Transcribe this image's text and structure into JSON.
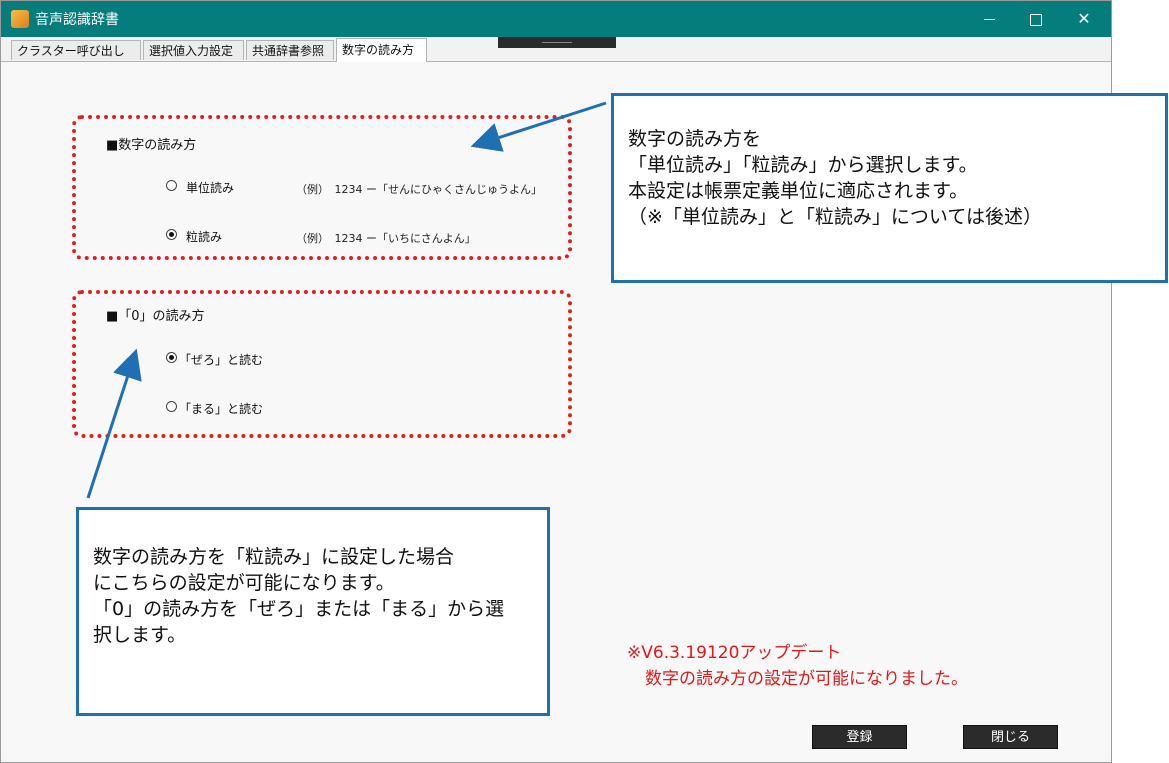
{
  "window": {
    "title": "音声認識辞書",
    "controls": {
      "minimize": "minimize",
      "maximize": "maximize",
      "close": "✕"
    }
  },
  "tabs": [
    {
      "label": "クラスター呼び出し設定",
      "active": false
    },
    {
      "label": "選択値入力設定",
      "active": false
    },
    {
      "label": "共通辞書参照",
      "active": false
    },
    {
      "label": "数字の読み方",
      "active": true
    }
  ],
  "reading_section": {
    "title": "■数字の読み方",
    "options": [
      {
        "label": "単位読み",
        "example": "（例）　1234 ー「せんにひゃくさんじゅうよん」",
        "selected": false
      },
      {
        "label": "粒読み",
        "example": "（例）　1234 ー「いちにさんよん」",
        "selected": true
      }
    ]
  },
  "zero_section": {
    "title": "■「0」の読み方",
    "options": [
      {
        "label": "「ぜろ」と読む",
        "selected": true
      },
      {
        "label": "「まる」と読む",
        "selected": false
      }
    ]
  },
  "callout_top": {
    "lines": [
      "数字の読み方を",
      "「単位読み」「粒読み」から選択します。",
      "本設定は帳票定義単位に適応されます。",
      "（※「単位読み」と「粒読み」については後述）"
    ]
  },
  "callout_bottom": {
    "lines": [
      "数字の読み方を「粒読み」に設定した場合",
      "にこちらの設定が可能になります。",
      "「0」の読み方を「ぜろ」または「まる」から選",
      "択します。"
    ]
  },
  "update_note": {
    "line1": "※V6.3.19120アップデート",
    "line2": "数字の読み方の設定が可能になりました。"
  },
  "buttons": {
    "register": "登録",
    "close": "閉じる"
  },
  "colors": {
    "titlebar": "#067d7d",
    "callout_border": "#1f6fb5",
    "group_border": "#e02020",
    "note_text": "#e01818"
  }
}
